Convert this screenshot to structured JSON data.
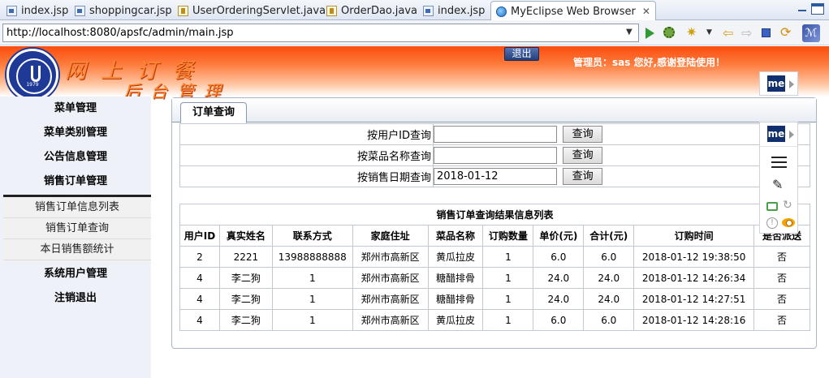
{
  "editor_tabs": [
    {
      "label": "index.jsp",
      "icon": "jsp-file-icon"
    },
    {
      "label": "shoppingcar.jsp",
      "icon": "jsp-file-icon"
    },
    {
      "label": "UserOrderingServlet.java",
      "icon": "java-file-icon"
    },
    {
      "label": "OrderDao.java",
      "icon": "java-file-icon"
    },
    {
      "label": "index.jsp",
      "icon": "jsp-file-icon"
    },
    {
      "label": "MyEclipse Web Browser",
      "icon": "globe-icon",
      "active": true
    }
  ],
  "browser": {
    "url": "http://localhost:8080/apsfc/admin/main.jsp"
  },
  "header": {
    "brand_line1": "网上订餐",
    "brand_line2": "后台管理",
    "logout_label": "退出",
    "welcome": "管理员：sas 您好,感谢登陆使用！",
    "accent": "#fb4d10"
  },
  "sidebar": {
    "items": [
      {
        "label": "菜单管理"
      },
      {
        "label": "菜单类别管理"
      },
      {
        "label": "公告信息管理"
      },
      {
        "label": "销售订单管理"
      }
    ],
    "subitems": [
      {
        "label": "销售订单信息列表"
      },
      {
        "label": "销售订单查询"
      },
      {
        "label": "本日销售额统计"
      }
    ],
    "items_after": [
      {
        "label": "系统用户管理"
      },
      {
        "label": "注销退出"
      }
    ]
  },
  "content": {
    "tab_label": "订单查询",
    "search": {
      "rows": [
        {
          "label": "按用户ID查询",
          "value": "",
          "button": "查询"
        },
        {
          "label": "按菜品名称查询",
          "value": "",
          "button": "查询"
        },
        {
          "label": "按销售日期查询",
          "value": "2018-01-12",
          "button": "查询"
        }
      ]
    },
    "results": {
      "caption": "销售订单查询结果信息列表",
      "columns": [
        "用户ID",
        "真实姓名",
        "联系方式",
        "家庭住址",
        "菜品名称",
        "订购数量",
        "单价(元)",
        "合计(元)",
        "订购时间",
        "是否派送"
      ],
      "rows": [
        [
          "2",
          "2221",
          "13988888888",
          "郑州市高新区",
          "黄瓜拉皮",
          "1",
          "6.0",
          "6.0",
          "2018-01-12 19:38:50",
          "否"
        ],
        [
          "4",
          "李二狗",
          "1",
          "郑州市高新区",
          "糖醋排骨",
          "1",
          "24.0",
          "24.0",
          "2018-01-12 14:26:34",
          "否"
        ],
        [
          "4",
          "李二狗",
          "1",
          "郑州市高新区",
          "糖醋排骨",
          "1",
          "24.0",
          "24.0",
          "2018-01-12 14:27:51",
          "否"
        ],
        [
          "4",
          "李二狗",
          "1",
          "郑州市高新区",
          "黄瓜拉皮",
          "1",
          "6.0",
          "6.0",
          "2018-01-12 14:28:16",
          "否"
        ]
      ]
    }
  },
  "myeclipse": {
    "logo_label": "me"
  }
}
